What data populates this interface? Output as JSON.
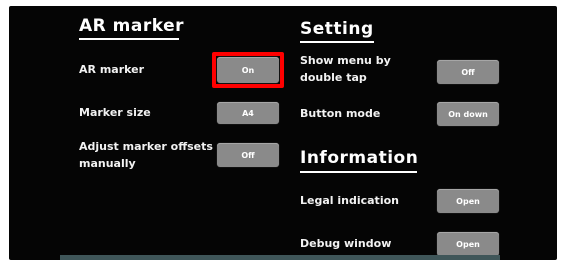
{
  "ar_marker": {
    "heading": "AR marker",
    "rows": [
      {
        "label": "AR marker",
        "button": "On"
      },
      {
        "label": "Marker size",
        "button": "A4"
      },
      {
        "label": "Adjust marker offsets\nmanually",
        "button": "Off"
      }
    ]
  },
  "setting": {
    "heading": "Setting",
    "rows": [
      {
        "label": "Show menu by\ndouble tap",
        "button": "Off"
      },
      {
        "label": "Button mode",
        "button": "On down"
      }
    ]
  },
  "information": {
    "heading": "Information",
    "rows": [
      {
        "label": "Legal indication",
        "button": "Open"
      },
      {
        "label": "Debug window",
        "button": "Open"
      }
    ]
  },
  "colors": {
    "highlight": "#ff0000",
    "button": "#8a8a8a",
    "background": "#050505"
  }
}
